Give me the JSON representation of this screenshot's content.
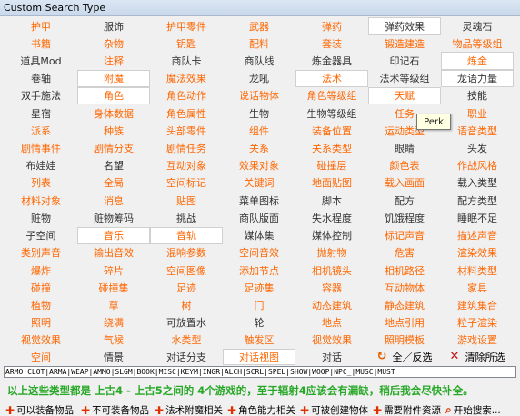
{
  "window": {
    "title": "Custom Search Type"
  },
  "grid": {
    "cells": [
      [
        {
          "t": "护甲",
          "c": "o"
        },
        {
          "t": "服饰",
          "c": "g"
        },
        {
          "t": "护甲零件",
          "c": "o"
        },
        {
          "t": "武器",
          "c": "o"
        },
        {
          "t": "弹药",
          "c": "o"
        },
        {
          "t": "弹药效果",
          "c": "g",
          "s": 1
        },
        {
          "t": "灵魂石",
          "c": "g"
        }
      ],
      [
        {
          "t": "书籍",
          "c": "o"
        },
        {
          "t": "杂物",
          "c": "o"
        },
        {
          "t": "钥匙",
          "c": "o"
        },
        {
          "t": "配料",
          "c": "o"
        },
        {
          "t": "套装",
          "c": "o"
        },
        {
          "t": "锻造建造",
          "c": "o"
        },
        {
          "t": "物品等级组",
          "c": "o"
        }
      ],
      [
        {
          "t": "道具Mod",
          "c": "g"
        },
        {
          "t": "注释",
          "c": "o"
        },
        {
          "t": "商队卡",
          "c": "g"
        },
        {
          "t": "商队线",
          "c": "g"
        },
        {
          "t": "炼金器具",
          "c": "g"
        },
        {
          "t": "印记石",
          "c": "g"
        },
        {
          "t": "炼金",
          "c": "o",
          "s": 1
        }
      ],
      [
        {
          "t": "卷轴",
          "c": "g"
        },
        {
          "t": "附魔",
          "c": "o",
          "s": 1
        },
        {
          "t": "魔法效果",
          "c": "o"
        },
        {
          "t": "龙吼",
          "c": "g"
        },
        {
          "t": "法术",
          "c": "o",
          "s": 1
        },
        {
          "t": "法术等级组",
          "c": "g"
        },
        {
          "t": "龙语力量",
          "c": "g",
          "s": 1
        }
      ],
      [
        {
          "t": "双手施法",
          "c": "g"
        },
        {
          "t": "角色",
          "c": "o",
          "s": 1
        },
        {
          "t": "角色动作",
          "c": "o"
        },
        {
          "t": "说话物体",
          "c": "o"
        },
        {
          "t": "角色等级组",
          "c": "o"
        },
        {
          "t": "天赋",
          "c": "o",
          "s": 1
        },
        {
          "t": "技能",
          "c": "g"
        }
      ],
      [
        {
          "t": "星宿",
          "c": "g"
        },
        {
          "t": "身体数据",
          "c": "o"
        },
        {
          "t": "角色属性",
          "c": "o"
        },
        {
          "t": "生物",
          "c": "g"
        },
        {
          "t": "生物等级组",
          "c": "g"
        },
        {
          "t": "任务",
          "c": "o"
        },
        {
          "t": "职业",
          "c": "o"
        }
      ],
      [
        {
          "t": "派系",
          "c": "o"
        },
        {
          "t": "种族",
          "c": "o"
        },
        {
          "t": "头部零件",
          "c": "o"
        },
        {
          "t": "组件",
          "c": "o"
        },
        {
          "t": "装备位置",
          "c": "o"
        },
        {
          "t": "运动类型",
          "c": "o"
        },
        {
          "t": "语音类型",
          "c": "o"
        }
      ],
      [
        {
          "t": "剧情事件",
          "c": "o"
        },
        {
          "t": "剧情分支",
          "c": "o"
        },
        {
          "t": "剧情任务",
          "c": "o"
        },
        {
          "t": "关系",
          "c": "o"
        },
        {
          "t": "关系类型",
          "c": "o"
        },
        {
          "t": "眼睛",
          "c": "g"
        },
        {
          "t": "头发",
          "c": "g"
        }
      ],
      [
        {
          "t": "布娃娃",
          "c": "g"
        },
        {
          "t": "名望",
          "c": "g"
        },
        {
          "t": "互动对象",
          "c": "o"
        },
        {
          "t": "效果对象",
          "c": "o"
        },
        {
          "t": "碰撞层",
          "c": "o"
        },
        {
          "t": "颜色表",
          "c": "o"
        },
        {
          "t": "作战风格",
          "c": "o"
        }
      ],
      [
        {
          "t": "列表",
          "c": "o"
        },
        {
          "t": "全局",
          "c": "o"
        },
        {
          "t": "空间标记",
          "c": "o"
        },
        {
          "t": "关键词",
          "c": "o"
        },
        {
          "t": "地面贴图",
          "c": "o"
        },
        {
          "t": "载入画面",
          "c": "o"
        },
        {
          "t": "载入类型",
          "c": "g"
        }
      ],
      [
        {
          "t": "材料对象",
          "c": "o"
        },
        {
          "t": "消息",
          "c": "o"
        },
        {
          "t": "贴图",
          "c": "o"
        },
        {
          "t": "菜单图标",
          "c": "g"
        },
        {
          "t": "脚本",
          "c": "g"
        },
        {
          "t": "配方",
          "c": "g"
        },
        {
          "t": "配方类型",
          "c": "g"
        }
      ],
      [
        {
          "t": "赃物",
          "c": "g"
        },
        {
          "t": "赃物筹码",
          "c": "g"
        },
        {
          "t": "挑战",
          "c": "g"
        },
        {
          "t": "商队版面",
          "c": "g"
        },
        {
          "t": "失水程度",
          "c": "g"
        },
        {
          "t": "饥饿程度",
          "c": "g"
        },
        {
          "t": "睡眠不足",
          "c": "g"
        }
      ],
      [
        {
          "t": "子空间",
          "c": "g"
        },
        {
          "t": "音乐",
          "c": "o",
          "s": 1
        },
        {
          "t": "音轨",
          "c": "o",
          "s": 1
        },
        {
          "t": "媒体集",
          "c": "g"
        },
        {
          "t": "媒体控制",
          "c": "g"
        },
        {
          "t": "标记声音",
          "c": "o"
        },
        {
          "t": "描述声音",
          "c": "o"
        }
      ],
      [
        {
          "t": "类别声音",
          "c": "o"
        },
        {
          "t": "输出音效",
          "c": "o"
        },
        {
          "t": "混响参数",
          "c": "o"
        },
        {
          "t": "空间音效",
          "c": "o"
        },
        {
          "t": "抛射物",
          "c": "o"
        },
        {
          "t": "危害",
          "c": "o"
        },
        {
          "t": "渲染效果",
          "c": "o"
        }
      ],
      [
        {
          "t": "爆炸",
          "c": "o"
        },
        {
          "t": "碎片",
          "c": "o"
        },
        {
          "t": "空间图像",
          "c": "o"
        },
        {
          "t": "添加节点",
          "c": "o"
        },
        {
          "t": "相机镜头",
          "c": "o"
        },
        {
          "t": "相机路径",
          "c": "o"
        },
        {
          "t": "材料类型",
          "c": "o"
        }
      ],
      [
        {
          "t": "碰撞",
          "c": "o"
        },
        {
          "t": "碰撞集",
          "c": "o"
        },
        {
          "t": "足迹",
          "c": "o"
        },
        {
          "t": "足迹集",
          "c": "o"
        },
        {
          "t": "容器",
          "c": "o"
        },
        {
          "t": "互动物体",
          "c": "o"
        },
        {
          "t": "家具",
          "c": "o"
        }
      ],
      [
        {
          "t": "植物",
          "c": "o"
        },
        {
          "t": "草",
          "c": "o"
        },
        {
          "t": "树",
          "c": "o"
        },
        {
          "t": "门",
          "c": "o"
        },
        {
          "t": "动态建筑",
          "c": "o"
        },
        {
          "t": "静态建筑",
          "c": "o"
        },
        {
          "t": "建筑集合",
          "c": "o"
        }
      ],
      [
        {
          "t": "照明",
          "c": "o"
        },
        {
          "t": "绕满",
          "c": "o"
        },
        {
          "t": "可放置水",
          "c": "g"
        },
        {
          "t": "轮",
          "c": "g"
        },
        {
          "t": "地点",
          "c": "o"
        },
        {
          "t": "地点引用",
          "c": "o"
        },
        {
          "t": "粒子渲染",
          "c": "o"
        }
      ],
      [
        {
          "t": "视觉效果",
          "c": "o"
        },
        {
          "t": "气候",
          "c": "o"
        },
        {
          "t": "水类型",
          "c": "o"
        },
        {
          "t": "触发区",
          "c": "o"
        },
        {
          "t": "视觉效果",
          "c": "o"
        },
        {
          "t": "照明模板",
          "c": "o"
        },
        {
          "t": "游戏设置",
          "c": "o"
        }
      ],
      [
        {
          "t": "空间",
          "c": "o"
        },
        {
          "t": "情景",
          "c": "g"
        },
        {
          "t": "对话分支",
          "c": "g"
        },
        {
          "t": "对话视图",
          "c": "o",
          "s": 1
        },
        {
          "t": "对话",
          "c": "g"
        }
      ]
    ],
    "select_all_label": "全／反选",
    "clear_label": "清除所选"
  },
  "tooltip": {
    "text": "Perk"
  },
  "type_codes": "ARMO|CLOT|ARMA|WEAP|AMMO|SLGM|BOOK|MISC|KEYM|INGR|ALCH|SCRL|SPEL|SHOW|WOOP|NPC_|MUSC|MUST",
  "note": "以上这些类型都是 上古4 - 上古5之间的 4个游戏的，至于辐射4应该会有漏缺，稍后我会尽快补全。",
  "bottom_bar": [
    "可以装备物品",
    "不可装备物品",
    "法术附魔相关",
    "角色能力相关",
    "可被创建物体",
    "需要附件资源",
    "开始搜索..."
  ]
}
